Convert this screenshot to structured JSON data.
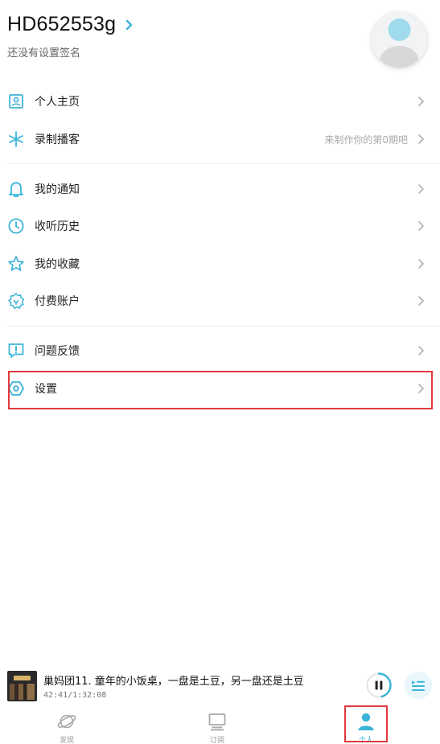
{
  "colors": {
    "accent": "#3bb4d8",
    "highlight_border": "#e0393e",
    "chevron": "#b0b0b0",
    "divider": "#eeeeee"
  },
  "profile": {
    "username": "HD652553g",
    "signature": "还没有设置签名"
  },
  "menu": {
    "items": [
      {
        "label": "个人主页",
        "icon": "person-card-icon"
      },
      {
        "label": "录制播客",
        "icon": "sparkle-icon",
        "hint": "来制作你的第0期吧"
      },
      {
        "label": "我的通知",
        "icon": "bell-icon"
      },
      {
        "label": "收听历史",
        "icon": "clock-icon"
      },
      {
        "label": "我的收藏",
        "icon": "star-icon"
      },
      {
        "label": "付费账户",
        "icon": "badge-icon"
      },
      {
        "label": "问题反馈",
        "icon": "feedback-icon"
      },
      {
        "label": "设置",
        "icon": "hexagon-gear-icon"
      }
    ]
  },
  "player": {
    "title": "巢妈团11. 童年的小饭桌，一盘是土豆，另一盘还是土豆",
    "time": "42:41/1:32:08",
    "progress_fraction": 0.46
  },
  "tabbar": {
    "tabs": [
      {
        "label": "发现",
        "icon": "planet-icon"
      },
      {
        "label": "订阅",
        "icon": "monitor-icon"
      },
      {
        "label": "个人",
        "icon": "person-icon",
        "active": true
      }
    ]
  }
}
